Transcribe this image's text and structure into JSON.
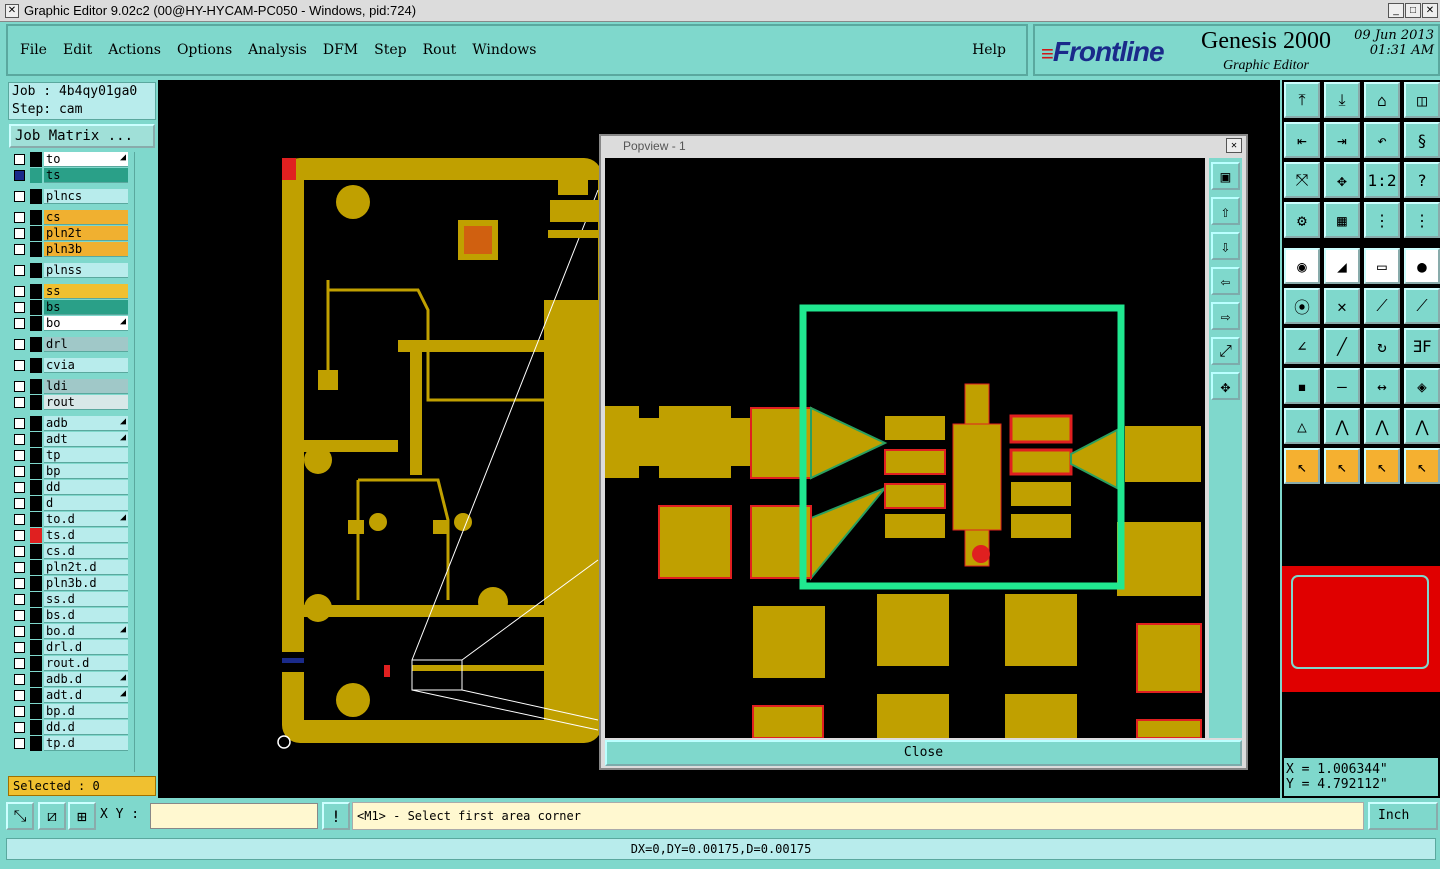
{
  "window": {
    "title": "Graphic Editor 9.02c2 (00@HY-HYCAM-PC050 - Windows, pid:724)"
  },
  "menu": {
    "items": [
      "File",
      "Edit",
      "Actions",
      "Options",
      "Analysis",
      "DFM",
      "Step",
      "Rout",
      "Windows"
    ],
    "help": "Help"
  },
  "brand": {
    "logo": "Frontline",
    "product": "Genesis 2000",
    "subtitle": "Graphic Editor",
    "date": "09 Jun 2013",
    "time": "01:31 AM"
  },
  "job": {
    "job_label": "Job : 4b4qy01ga0",
    "step_label": "Step: cam",
    "matrix_button": "Job Matrix ..."
  },
  "layers": [
    {
      "name": "to",
      "color": "#ffffff",
      "swatch": "#000000",
      "checked": false,
      "edit": true
    },
    {
      "name": "ts",
      "color": "#2aa088",
      "swatch": "#2aa088",
      "checked": true,
      "edit": false
    },
    {
      "name": "plncs",
      "color": "#b8ecec",
      "swatch": "#000000",
      "checked": false,
      "edit": false
    },
    {
      "name": "cs",
      "color": "#f0b030",
      "swatch": "#000000",
      "checked": false,
      "edit": false
    },
    {
      "name": "pln2t",
      "color": "#f0b030",
      "swatch": "#000000",
      "checked": false,
      "edit": false
    },
    {
      "name": "pln3b",
      "color": "#f0b030",
      "swatch": "#000000",
      "checked": false,
      "edit": false
    },
    {
      "name": "plnss",
      "color": "#b8ecec",
      "swatch": "#000000",
      "checked": false,
      "edit": false
    },
    {
      "name": "ss",
      "color": "#f0c030",
      "swatch": "#000000",
      "checked": false,
      "edit": false
    },
    {
      "name": "bs",
      "color": "#2aa088",
      "swatch": "#000000",
      "checked": false,
      "edit": false
    },
    {
      "name": "bo",
      "color": "#ffffff",
      "swatch": "#000000",
      "checked": false,
      "edit": true
    },
    {
      "name": "drl",
      "color": "#a0c8c8",
      "swatch": "#000000",
      "checked": false,
      "edit": false
    },
    {
      "name": "cvia",
      "color": "#b8ecec",
      "swatch": "#000000",
      "checked": false,
      "edit": false
    },
    {
      "name": "ldi",
      "color": "#a0c8c8",
      "swatch": "#000000",
      "checked": false,
      "edit": false
    },
    {
      "name": "rout",
      "color": "#d8e8e8",
      "swatch": "#000000",
      "checked": false,
      "edit": false
    },
    {
      "name": "adb",
      "color": "#b8ecec",
      "swatch": "#000000",
      "checked": false,
      "edit": true
    },
    {
      "name": "adt",
      "color": "#b8ecec",
      "swatch": "#000000",
      "checked": false,
      "edit": true
    },
    {
      "name": "tp",
      "color": "#b8ecec",
      "swatch": "#000000",
      "checked": false,
      "edit": false
    },
    {
      "name": "bp",
      "color": "#b8ecec",
      "swatch": "#000000",
      "checked": false,
      "edit": false
    },
    {
      "name": "dd",
      "color": "#b8ecec",
      "swatch": "#000000",
      "checked": false,
      "edit": false
    },
    {
      "name": "d",
      "color": "#b8ecec",
      "swatch": "#000000",
      "checked": false,
      "edit": false
    },
    {
      "name": "to.d",
      "color": "#b8ecec",
      "swatch": "#000000",
      "checked": false,
      "edit": true
    },
    {
      "name": "ts.d",
      "color": "#b8ecec",
      "swatch": "#e02020",
      "checked": false,
      "edit": false
    },
    {
      "name": "cs.d",
      "color": "#b8ecec",
      "swatch": "#000000",
      "checked": false,
      "edit": false
    },
    {
      "name": "pln2t.d",
      "color": "#b8ecec",
      "swatch": "#000000",
      "checked": false,
      "edit": false
    },
    {
      "name": "pln3b.d",
      "color": "#b8ecec",
      "swatch": "#000000",
      "checked": false,
      "edit": false
    },
    {
      "name": "ss.d",
      "color": "#b8ecec",
      "swatch": "#000000",
      "checked": false,
      "edit": false
    },
    {
      "name": "bs.d",
      "color": "#b8ecec",
      "swatch": "#000000",
      "checked": false,
      "edit": false
    },
    {
      "name": "bo.d",
      "color": "#b8ecec",
      "swatch": "#000000",
      "checked": false,
      "edit": true
    },
    {
      "name": "drl.d",
      "color": "#b8ecec",
      "swatch": "#000000",
      "checked": false,
      "edit": false
    },
    {
      "name": "rout.d",
      "color": "#b8ecec",
      "swatch": "#000000",
      "checked": false,
      "edit": false
    },
    {
      "name": "adb.d",
      "color": "#b8ecec",
      "swatch": "#000000",
      "checked": false,
      "edit": true
    },
    {
      "name": "adt.d",
      "color": "#b8ecec",
      "swatch": "#000000",
      "checked": false,
      "edit": true
    },
    {
      "name": "bp.d",
      "color": "#b8ecec",
      "swatch": "#000000",
      "checked": false,
      "edit": false
    },
    {
      "name": "dd.d",
      "color": "#b8ecec",
      "swatch": "#000000",
      "checked": false,
      "edit": false
    },
    {
      "name": "tp.d",
      "color": "#b8ecec",
      "swatch": "#000000",
      "checked": false,
      "edit": false
    }
  ],
  "selected": "Selected : 0",
  "popview": {
    "title": "Popview - 1",
    "close_button": "Close"
  },
  "coords": {
    "x": "X = 1.006344\"",
    "y": "Y = 4.792112\""
  },
  "command": {
    "xy_label": "X Y :",
    "xy_value": "",
    "prompt": "<M1> - Select first area corner",
    "unit": "Inch"
  },
  "status": "DX=0,DY=0.00175,D=0.00175",
  "colors": {
    "copper": "#c0a000",
    "pad_outline": "#e02020",
    "highlight": "#20e890",
    "panel": "#7fd8cc"
  }
}
